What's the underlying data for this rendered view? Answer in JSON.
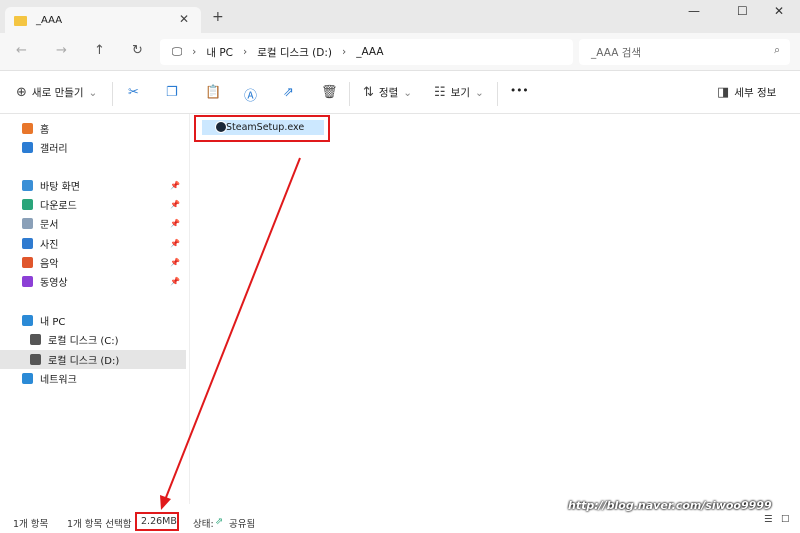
{
  "tab": {
    "title": "_AAA"
  },
  "window": {
    "minimize": "—",
    "maximize": "☐",
    "close": "✕",
    "new_tab": "+",
    "tab_close": "✕"
  },
  "nav": {
    "back": "←",
    "forward": "→",
    "up": "↑",
    "refresh": "↻"
  },
  "breadcrumb": [
    "내 PC",
    "로컬 디스크 (D:)",
    "_AAA"
  ],
  "search": {
    "placeholder": "_AAA 검색"
  },
  "toolbar": {
    "new": "새로 만들기",
    "sort": "정렬",
    "view": "보기",
    "more": "•••",
    "details": "세부 정보"
  },
  "sidebar": {
    "items": [
      {
        "label": "홈",
        "color": "#e8762b"
      },
      {
        "label": "갤러리",
        "color": "#2b7cd3"
      },
      {
        "label": "바탕 화면",
        "color": "#3a8fd6",
        "pinned": true
      },
      {
        "label": "다운로드",
        "color": "#2aa57a",
        "pinned": true
      },
      {
        "label": "문서",
        "color": "#8aa0b8",
        "pinned": true
      },
      {
        "label": "사진",
        "color": "#2f7bd0",
        "pinned": true
      },
      {
        "label": "음악",
        "color": "#e0562c",
        "pinned": true
      },
      {
        "label": "동영상",
        "color": "#8c3fd6",
        "pinned": true
      },
      {
        "label": "내 PC",
        "color": "#2b8ad6"
      },
      {
        "label": "로컬 디스크 (C:)",
        "color": "#555"
      },
      {
        "label": "로컬 디스크 (D:)",
        "color": "#555"
      },
      {
        "label": "네트워크",
        "color": "#2b8ad6"
      }
    ]
  },
  "files": [
    {
      "name": "SteamSetup.exe"
    }
  ],
  "status": {
    "count": "1개 항목",
    "selected": "1개 항목 선택함",
    "size": "2.26MB",
    "state": "상태:",
    "shared": "공유됨"
  },
  "watermark": "http://blog.naver.com/siwoo9999",
  "colors": {
    "accent": "#e0191b",
    "selection": "#cce8ff"
  }
}
